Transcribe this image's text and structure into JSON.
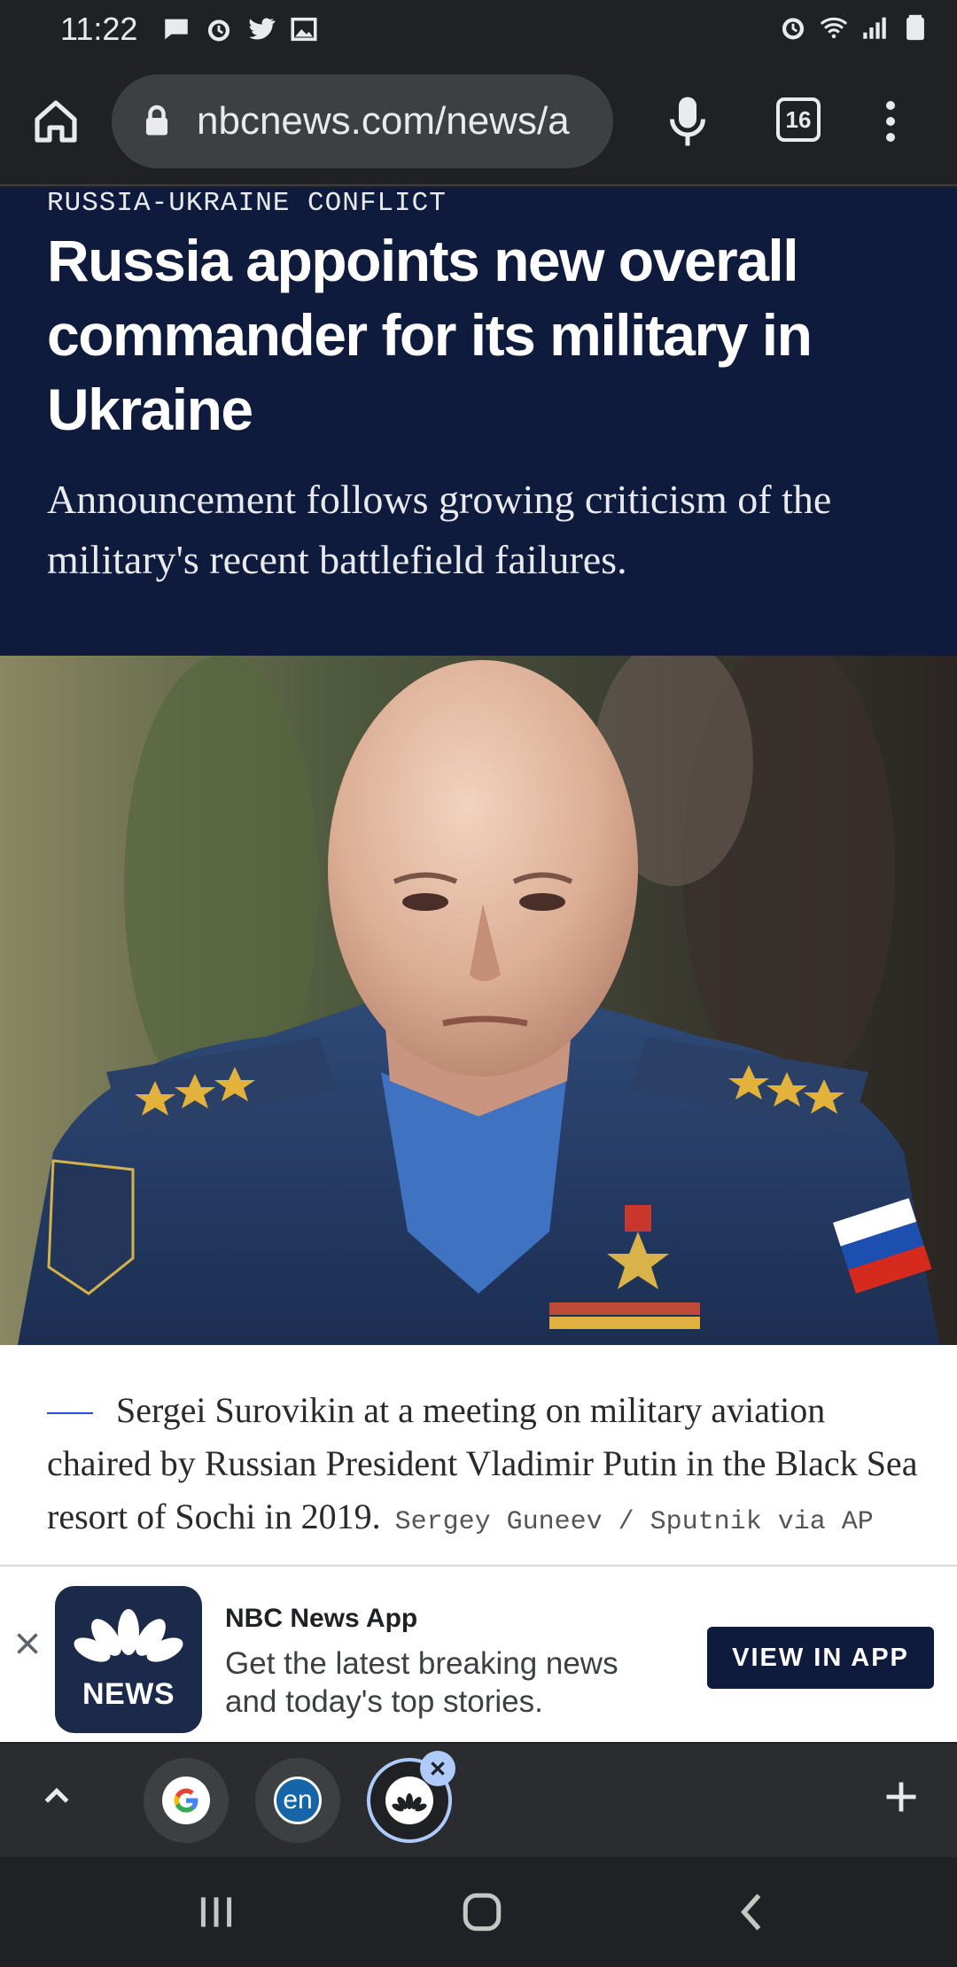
{
  "status_bar": {
    "time": "11:22",
    "left_icons": [
      "chat-icon",
      "alarm-icon",
      "twitter-icon",
      "image-icon"
    ],
    "right_icons": [
      "alarm-icon",
      "wifi-icon",
      "signal-icon",
      "battery-icon"
    ]
  },
  "browser": {
    "url": "nbcnews.com/news/a",
    "tab_count": "16"
  },
  "article": {
    "eyebrow": "RUSSIA-UKRAINE CONFLICT",
    "headline": "Russia appoints new overall commander for its military in Ukraine",
    "dek": "Announcement follows growing criticism of the military's recent battlefield failures.",
    "image_alt": "Sergei Surovikin",
    "caption": "Sergei Surovikin at a meeting on military aviation chaired by Russian President Vladimir Putin in the Black Sea resort of Sochi in 2019.",
    "credit": "Sergey Guneev / Sputnik via AP file"
  },
  "app_banner": {
    "logo_text": "NEWS",
    "app_name": "NBC News App",
    "description": "Get the latest breaking news and today's top stories.",
    "button_label": "VIEW IN APP"
  },
  "tab_strip": {
    "tabs": [
      {
        "favicon": "G",
        "name": "google"
      },
      {
        "favicon": "en",
        "name": "en"
      },
      {
        "favicon": "nbc",
        "name": "nbc",
        "selected": true
      }
    ]
  },
  "colors": {
    "header_bg": "#0f1b3c",
    "chrome_bg": "#202124",
    "accent_blue": "#1f4ee0",
    "tab_selected": "#aecbfa"
  }
}
